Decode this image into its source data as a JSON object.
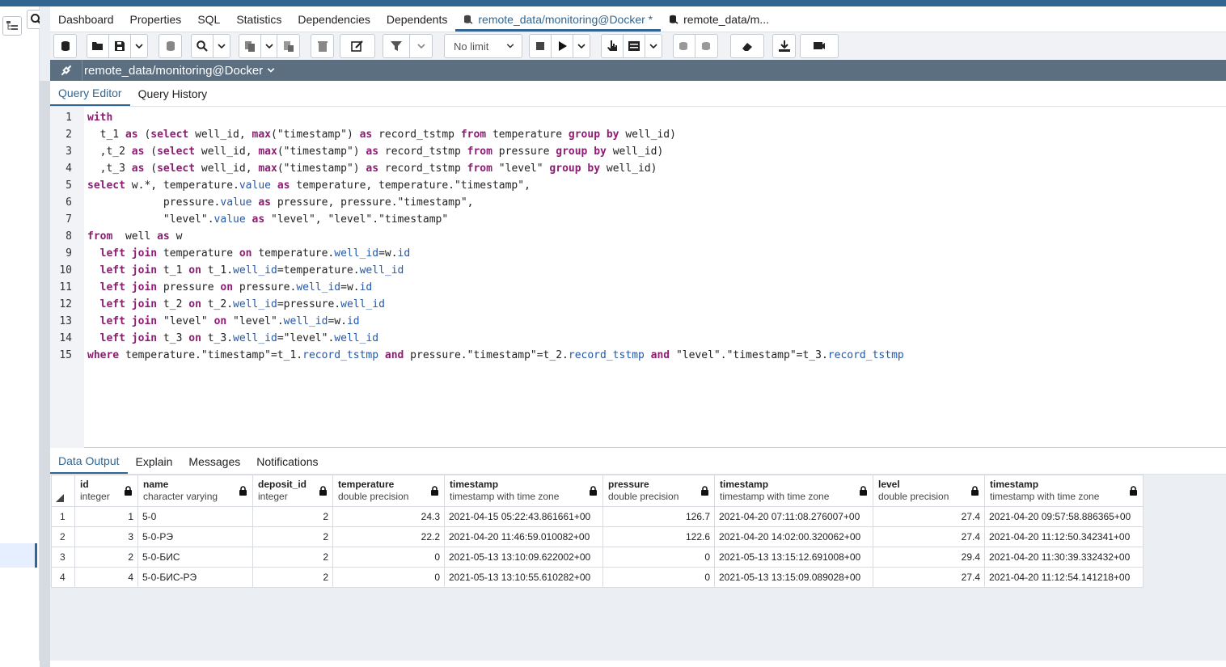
{
  "tabs": [
    {
      "label": "Dashboard"
    },
    {
      "label": "Properties"
    },
    {
      "label": "SQL"
    },
    {
      "label": "Statistics"
    },
    {
      "label": "Dependencies"
    },
    {
      "label": "Dependents"
    },
    {
      "label": "remote_data/monitoring@Docker *"
    },
    {
      "label": "remote_data/m..."
    }
  ],
  "toolbar": {
    "limit_label": "No limit"
  },
  "connection": {
    "label": "remote_data/monitoring@Docker"
  },
  "editor_tabs": [
    {
      "label": "Query Editor"
    },
    {
      "label": "Query History"
    }
  ],
  "sql_lines": [
    "with",
    "  t_1 as (select well_id, max(\"timestamp\") as record_tstmp from temperature group by well_id)",
    "  ,t_2 as (select well_id, max(\"timestamp\") as record_tstmp from pressure group by well_id)",
    "  ,t_3 as (select well_id, max(\"timestamp\") as record_tstmp from \"level\" group by well_id)",
    "select w.*, temperature.value as temperature, temperature.\"timestamp\",",
    "            pressure.value as pressure, pressure.\"timestamp\",",
    "            \"level\".value as \"level\", \"level\".\"timestamp\"",
    "from  well as w",
    "  left join temperature on temperature.well_id=w.id",
    "  left join t_1 on t_1.well_id=temperature.well_id",
    "  left join pressure on pressure.well_id=w.id",
    "  left join t_2 on t_2.well_id=pressure.well_id",
    "  left join \"level\" on \"level\".well_id=w.id",
    "  left join t_3 on t_3.well_id=\"level\".well_id",
    "where temperature.\"timestamp\"=t_1.record_tstmp and pressure.\"timestamp\"=t_2.record_tstmp and \"level\".\"timestamp\"=t_3.record_tstmp"
  ],
  "output_tabs": [
    {
      "label": "Data Output"
    },
    {
      "label": "Explain"
    },
    {
      "label": "Messages"
    },
    {
      "label": "Notifications"
    }
  ],
  "columns": [
    {
      "name": "id",
      "type": "integer"
    },
    {
      "name": "name",
      "type": "character varying"
    },
    {
      "name": "deposit_id",
      "type": "integer"
    },
    {
      "name": "temperature",
      "type": "double precision"
    },
    {
      "name": "timestamp",
      "type": "timestamp with time zone"
    },
    {
      "name": "pressure",
      "type": "double precision"
    },
    {
      "name": "timestamp",
      "type": "timestamp with time zone"
    },
    {
      "name": "level",
      "type": "double precision"
    },
    {
      "name": "timestamp",
      "type": "timestamp with time zone"
    }
  ],
  "rows": [
    [
      "1",
      "1",
      "5-0",
      "2",
      "24.3",
      "2021-04-15 05:22:43.861661+00",
      "126.7",
      "2021-04-20 07:11:08.276007+00",
      "27.4",
      "2021-04-20 09:57:58.886365+00"
    ],
    [
      "2",
      "3",
      "5-0-РЭ",
      "2",
      "22.2",
      "2021-04-20 11:46:59.010082+00",
      "122.6",
      "2021-04-20 14:02:00.320062+00",
      "27.4",
      "2021-04-20 11:12:50.342341+00"
    ],
    [
      "3",
      "2",
      "5-0-БИС",
      "2",
      "0",
      "2021-05-13 13:10:09.622002+00",
      "0",
      "2021-05-13 13:15:12.691008+00",
      "29.4",
      "2021-04-20 11:30:39.332432+00"
    ],
    [
      "4",
      "4",
      "5-0-БИС-РЭ",
      "2",
      "0",
      "2021-05-13 13:10:55.610282+00",
      "0",
      "2021-05-13 13:15:09.089028+00",
      "27.4",
      "2021-04-20 11:12:54.141218+00"
    ]
  ]
}
